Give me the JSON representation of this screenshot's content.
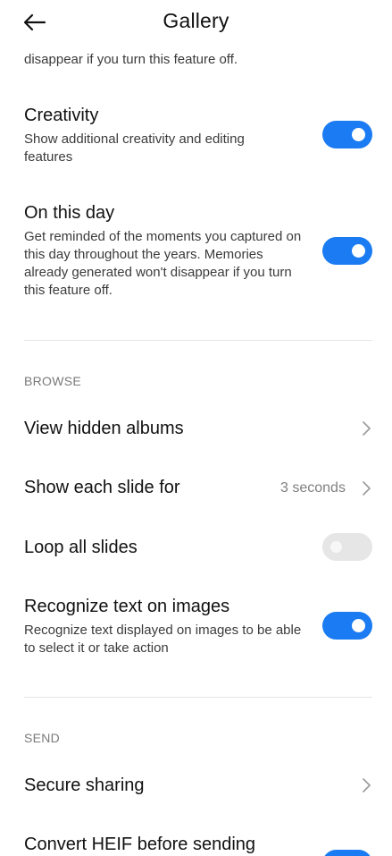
{
  "header": {
    "title": "Gallery"
  },
  "top_fragment": "disappear if you turn this feature off.",
  "creativity": {
    "title": "Creativity",
    "description": "Show additional creativity and editing features",
    "enabled": true
  },
  "on_this_day": {
    "title": "On this day",
    "description": "Get reminded of the moments you captured on this day throughout the years. Memories already generated won't disappear if you turn this feature off.",
    "enabled": true
  },
  "browse": {
    "section_label": "BROWSE",
    "view_hidden_albums": {
      "title": "View hidden albums"
    },
    "show_each_slide": {
      "title": "Show each slide for",
      "value": "3 seconds"
    },
    "loop_all_slides": {
      "title": "Loop all slides",
      "enabled": false
    },
    "recognize_text": {
      "title": "Recognize text on images",
      "description": "Recognize text displayed on images to be able to select it or take action",
      "enabled": true
    }
  },
  "send": {
    "section_label": "SEND",
    "secure_sharing": {
      "title": "Secure sharing"
    },
    "convert_heif": {
      "title": "Convert HEIF before sending"
    }
  },
  "colors": {
    "accent": "#1a7bf2",
    "toggle_off": "#e6e6e6"
  }
}
